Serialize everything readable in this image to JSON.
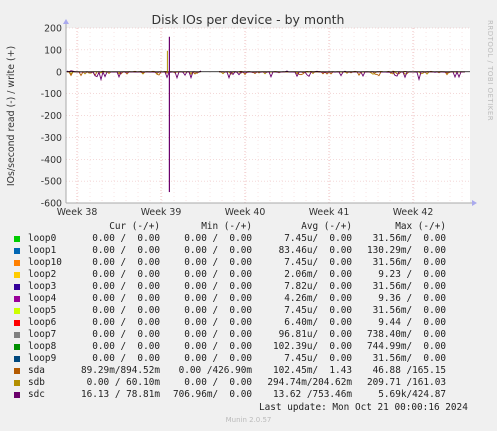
{
  "chart_data": {
    "type": "line",
    "title": "Disk IOs per device - by month",
    "ylabel": "IOs/second read (-) / write (+)",
    "ylim": [
      -600,
      200
    ],
    "yticks": [
      200,
      100,
      0,
      -100,
      -200,
      -300,
      -400,
      -500,
      -600
    ],
    "xticks": [
      "Week 38",
      "Week 39",
      "Week 40",
      "Week 41",
      "Week 42"
    ],
    "grid": true,
    "spike": {
      "week": 39.1,
      "max": 160,
      "min": -550
    }
  },
  "legend": {
    "headers": {
      "cur": "Cur (-/+)",
      "min": "Min (-/+)",
      "avg": "Avg (-/+)",
      "max": "Max (-/+)"
    },
    "rows": [
      {
        "name": "loop0",
        "color": "#00cc00",
        "cur": "0.00 /  0.00",
        "min": "0.00 /  0.00",
        "avg": "7.45u/  0.00",
        "max": "31.56m/  0.00"
      },
      {
        "name": "loop1",
        "color": "#0066b3",
        "cur": "0.00 /  0.00",
        "min": "0.00 /  0.00",
        "avg": "83.46u/  0.00",
        "max": "130.29m/  0.00"
      },
      {
        "name": "loop10",
        "color": "#ff8000",
        "cur": "0.00 /  0.00",
        "min": "0.00 /  0.00",
        "avg": "7.45u/  0.00",
        "max": "31.56m/  0.00"
      },
      {
        "name": "loop2",
        "color": "#ffcc00",
        "cur": "0.00 /  0.00",
        "min": "0.00 /  0.00",
        "avg": "2.06m/  0.00",
        "max": "9.23 /  0.00"
      },
      {
        "name": "loop3",
        "color": "#330099",
        "cur": "0.00 /  0.00",
        "min": "0.00 /  0.00",
        "avg": "7.82u/  0.00",
        "max": "31.56m/  0.00"
      },
      {
        "name": "loop4",
        "color": "#990099",
        "cur": "0.00 /  0.00",
        "min": "0.00 /  0.00",
        "avg": "4.26m/  0.00",
        "max": "9.36 /  0.00"
      },
      {
        "name": "loop5",
        "color": "#ccff00",
        "cur": "0.00 /  0.00",
        "min": "0.00 /  0.00",
        "avg": "7.45u/  0.00",
        "max": "31.56m/  0.00"
      },
      {
        "name": "loop6",
        "color": "#ff0000",
        "cur": "0.00 /  0.00",
        "min": "0.00 /  0.00",
        "avg": "6.40m/  0.00",
        "max": "9.44 /  0.00"
      },
      {
        "name": "loop7",
        "color": "#808080",
        "cur": "0.00 /  0.00",
        "min": "0.00 /  0.00",
        "avg": "96.81u/  0.00",
        "max": "738.40m/  0.00"
      },
      {
        "name": "loop8",
        "color": "#008f00",
        "cur": "0.00 /  0.00",
        "min": "0.00 /  0.00",
        "avg": "102.39u/  0.00",
        "max": "744.99m/  0.00"
      },
      {
        "name": "loop9",
        "color": "#00487d",
        "cur": "0.00 /  0.00",
        "min": "0.00 /  0.00",
        "avg": "7.45u/  0.00",
        "max": "31.56m/  0.00"
      },
      {
        "name": "sda",
        "color": "#b35a00",
        "cur": "89.29m/894.52m",
        "min": "0.00 /426.90m",
        "avg": "102.45m/  1.43",
        "max": "46.88 /165.15"
      },
      {
        "name": "sdb",
        "color": "#b38f00",
        "cur": "0.00 / 60.10m",
        "min": "0.00 /  0.00",
        "avg": "294.74m/204.62m",
        "max": "209.71 /161.03"
      },
      {
        "name": "sdc",
        "color": "#6b006b",
        "cur": "16.13 / 78.81m",
        "min": "706.96m/  0.00",
        "avg": "13.62 /753.46m",
        "max": "5.69k/424.87"
      }
    ]
  },
  "footer": {
    "last_update": "Last update: Mon Oct 21 00:00:16 2024",
    "munin": "Munin 2.0.57",
    "rrdtool": "RRDTOOL / TOBI OETIKER"
  }
}
